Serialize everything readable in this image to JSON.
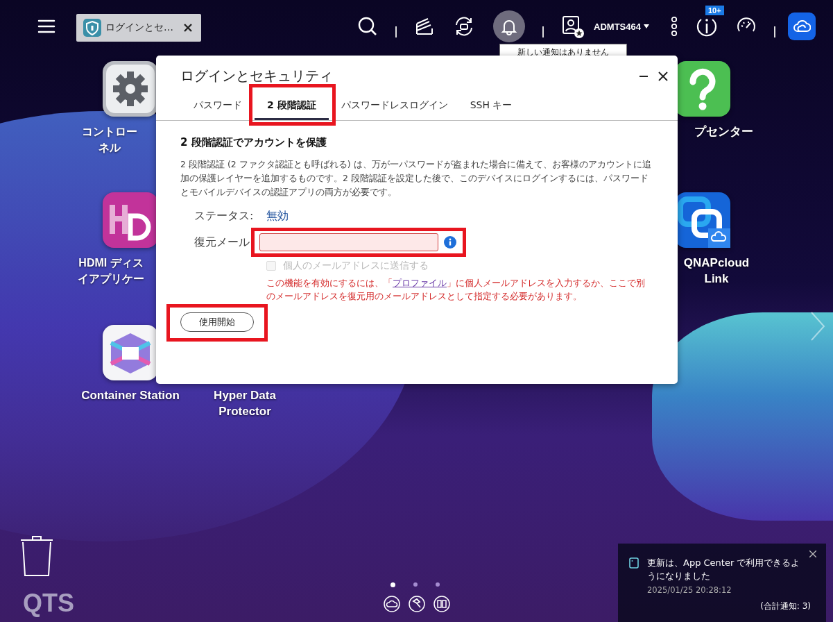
{
  "top_bar": {
    "app_tab": {
      "label": "ログインとセ…",
      "selected": true
    },
    "bell_active": true,
    "user_name": "ADMTS464",
    "info_badge": "10+",
    "tooltip": "新しい通知はありません"
  },
  "desktop_icons": [
    {
      "kind": "settings",
      "lines": [
        "コントロー",
        "ネル"
      ]
    },
    {
      "kind": "hd",
      "lines": [
        "HDMI ディス",
        "イアプリケー"
      ]
    },
    {
      "kind": "container",
      "lines": [
        "Container Station"
      ]
    },
    {
      "kind": "hidden",
      "lines": [
        "Hyper Data",
        "Protector"
      ]
    },
    {
      "kind": "help",
      "lines": [
        "プセンター"
      ]
    },
    {
      "kind": "link",
      "lines": [
        "QNAPcloud",
        "Link"
      ]
    }
  ],
  "dialog": {
    "title": "ログインとセキュリティ",
    "tabs": [
      {
        "label": "パスワード",
        "selected": false
      },
      {
        "label": "2 段階認証",
        "selected": true
      },
      {
        "label": "パスワードレスログイン",
        "selected": false
      },
      {
        "label": "SSH キー",
        "selected": false
      }
    ],
    "heading": "2 段階認証でアカウントを保護",
    "description": "2 段階認証 (2 ファクタ認証とも呼ばれる) は、万が一パスワードが盗まれた場合に備えて、お客様のアカウントに追加の保護レイヤーを追加するものです。2 段階認証を設定した後で、このデバイスにログインするには、パスワードとモバイルデバイスの認証アプリの両方が必要です。",
    "status_label": "ステータス:",
    "status_value": "無効",
    "email_label": "復元メール",
    "email_invalid": true,
    "checkbox": {
      "label": "個人のメールアドレスに送信する",
      "checked": false,
      "disabled": true
    },
    "warning_before": "この機能を有効にするには、「",
    "warning_link": "プロファイル",
    "warning_after": "」に個人メールアドレスを入力するか、ここで別のメールアドレスを復元用のメールアドレスとして指定する必要があります。",
    "start_button": "使用開始"
  },
  "logo": "QTS",
  "pager": [
    {
      "selected": true
    },
    {
      "selected": false
    },
    {
      "selected": false
    }
  ],
  "notification": {
    "message": "更新は、App Center で利用できるようになりました",
    "time": "2025/01/25 20:28:12",
    "total": "(合計通知: 3)"
  }
}
